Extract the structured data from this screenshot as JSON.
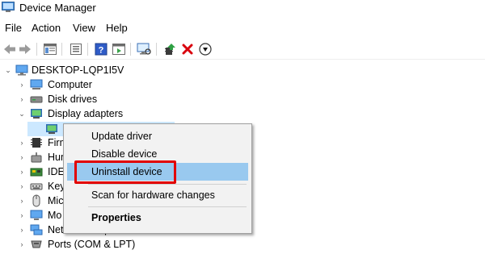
{
  "window": {
    "title": "Device Manager"
  },
  "menubar": {
    "items": [
      "File",
      "Action",
      "View",
      "Help"
    ]
  },
  "tree": {
    "root": "DESKTOP-LQP1I5V",
    "items": [
      {
        "label": "Computer",
        "icon": "computer-icon"
      },
      {
        "label": "Disk drives",
        "icon": "disk-drive-icon"
      },
      {
        "label": "Display adapters",
        "icon": "display-adapter-icon"
      },
      {
        "label": "",
        "icon": "display-adapter-icon"
      },
      {
        "label": "Firm",
        "icon": "firmware-icon"
      },
      {
        "label": "Hum",
        "icon": "hid-icon"
      },
      {
        "label": "IDE",
        "icon": "ide-icon"
      },
      {
        "label": "Key",
        "icon": "keyboard-icon"
      },
      {
        "label": "Mic",
        "icon": "mouse-icon"
      },
      {
        "label": "Mo",
        "icon": "monitor-icon"
      },
      {
        "label": "Network adapters",
        "icon": "network-adapter-icon"
      },
      {
        "label": "Ports (COM & LPT)",
        "icon": "port-icon"
      }
    ]
  },
  "context_menu": {
    "items": [
      "Update driver",
      "Disable device",
      "Uninstall device",
      "Scan for hardware changes",
      "Properties"
    ],
    "highlighted": "Uninstall device"
  },
  "colors": {
    "highlight": "#99c9ef",
    "selection": "#cce8ff",
    "annotation": "#e20000",
    "delete": "#d9000d"
  }
}
